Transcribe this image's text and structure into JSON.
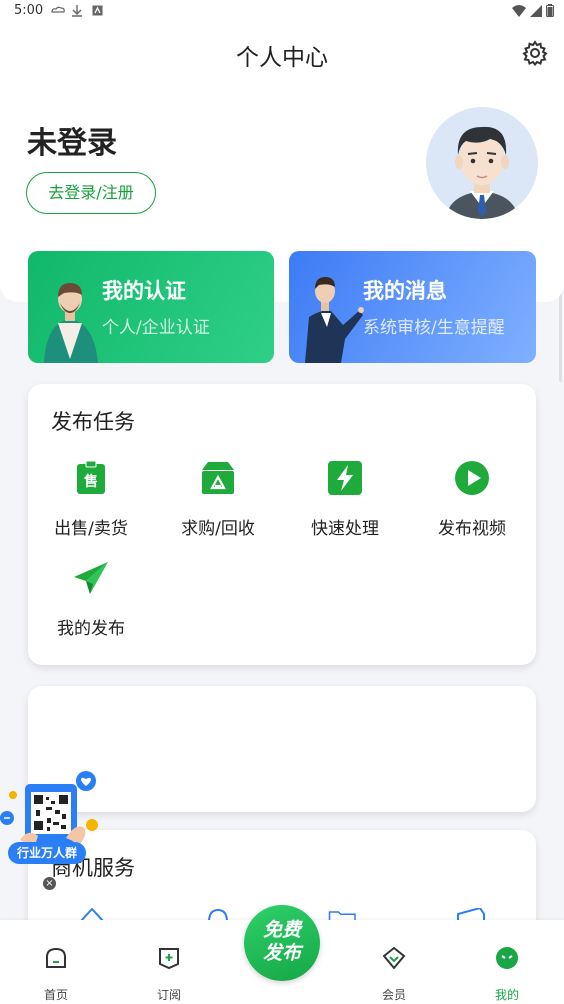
{
  "status_bar": {
    "time": "5:00"
  },
  "header": {
    "title": "个人中心"
  },
  "profile": {
    "name": "未登录",
    "login_label": "去登录/注册"
  },
  "cards": {
    "cert": {
      "title": "我的认证",
      "subtitle": "个人/企业认证"
    },
    "msg": {
      "title": "我的消息",
      "subtitle": "系统审核/生意提醒"
    }
  },
  "publish": {
    "title": "发布任务",
    "items": [
      {
        "label": "出售/卖货",
        "icon": "sell-icon"
      },
      {
        "label": "求购/回收",
        "icon": "purchase-icon"
      },
      {
        "label": "快速处理",
        "icon": "lightning-icon"
      },
      {
        "label": "发布视频",
        "icon": "video-icon"
      },
      {
        "label": "我的发布",
        "icon": "paper-plane-icon"
      }
    ]
  },
  "service": {
    "title": "商机服务"
  },
  "qr_float": {
    "badge": "行业万人群"
  },
  "fab": {
    "line1": "免费",
    "line2": "发布"
  },
  "tabbar": {
    "items": [
      {
        "label": "首页",
        "icon": "home-icon"
      },
      {
        "label": "订阅",
        "icon": "subscribe-icon"
      },
      {
        "label": "会员",
        "icon": "vip-icon"
      },
      {
        "label": "我的",
        "icon": "mine-icon",
        "active": true
      }
    ]
  },
  "colors": {
    "brand_green": "#17a13a",
    "msg_blue": "#3d7bf5",
    "cert_green": "#10b86a"
  }
}
